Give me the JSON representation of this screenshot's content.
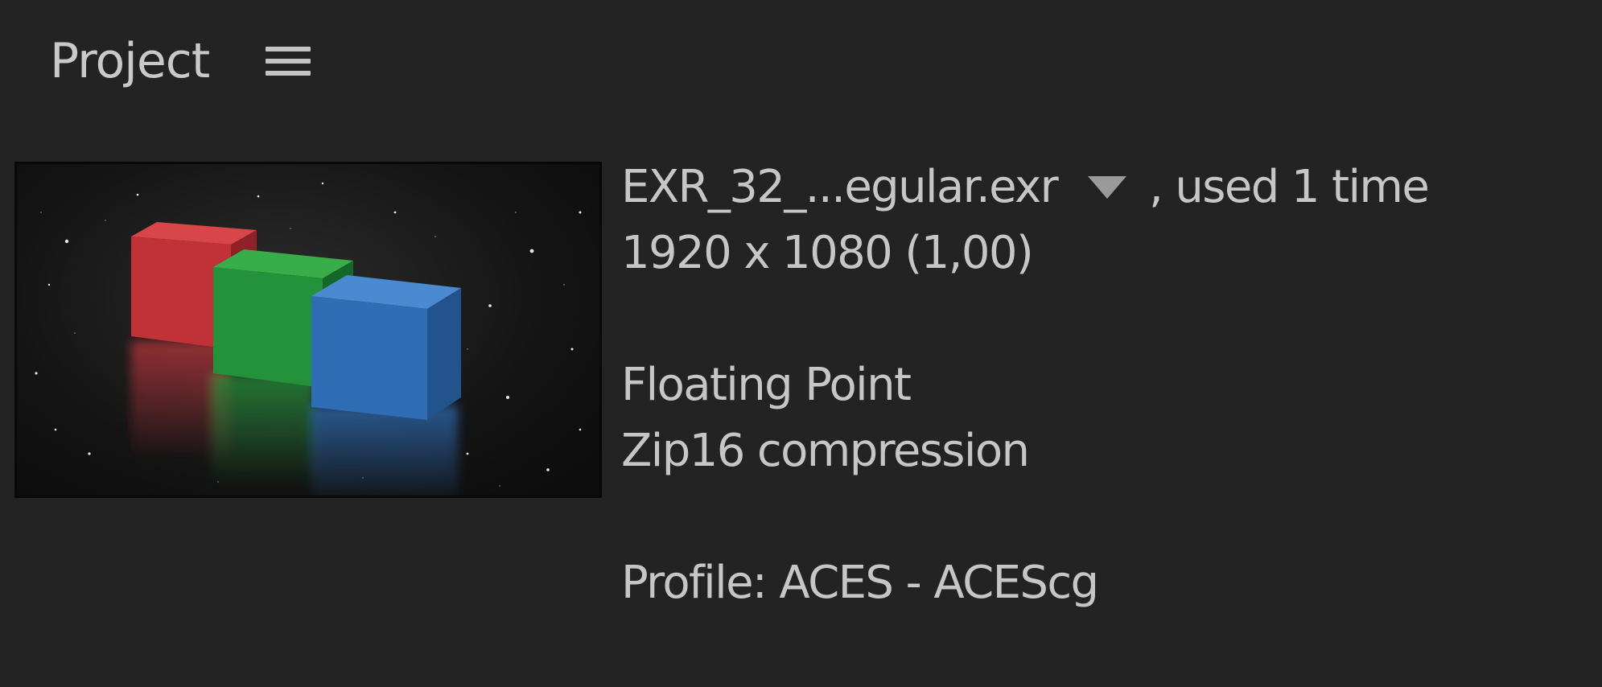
{
  "panel": {
    "title": "Project",
    "menu_icon": "hamburger-menu-icon"
  },
  "footage": {
    "thumbnail": "rgb-cubes-preview",
    "filename": "EXR_32_...egular.exr",
    "usage": ", used 1 time",
    "dimensions": "1920 x 1080 (1,00)",
    "bit_depth": "Floating Point",
    "compression": "Zip16 compression",
    "profile": "Profile: ACES - ACEScg"
  },
  "colors": {
    "background": "#232323",
    "text": "#c6c6c6",
    "cube_red": "#c73539",
    "cube_green": "#2a9a3c",
    "cube_blue": "#2f6db5"
  }
}
